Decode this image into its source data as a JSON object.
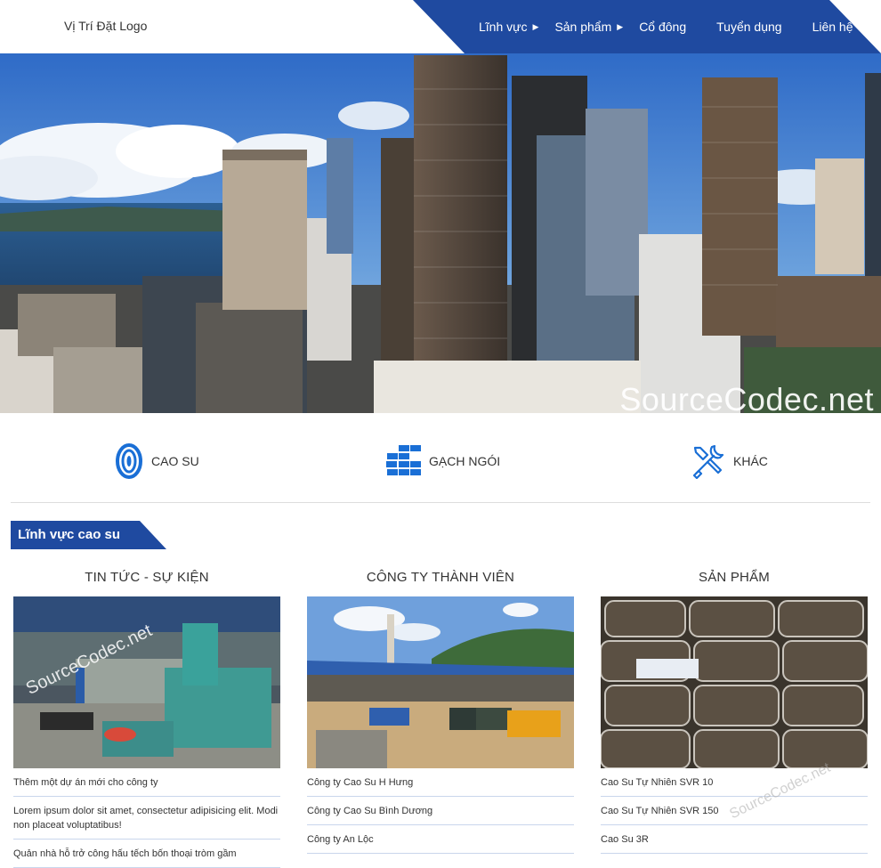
{
  "header": {
    "logo_text": "Vị Trí Đặt Logo",
    "nav": [
      {
        "label": "Lĩnh vực",
        "has_submenu": true
      },
      {
        "label": "Sản phẩm",
        "has_submenu": true
      },
      {
        "label": "Cổ đông",
        "has_submenu": false
      },
      {
        "label": "Tuyển dụng",
        "has_submenu": false
      },
      {
        "label": "Liên hệ",
        "has_submenu": false
      }
    ],
    "nav_caret": "▶",
    "accent_color": "#1f4aa0"
  },
  "hero": {
    "watermark": "SourceCodec.net"
  },
  "categories": [
    {
      "label": "CAO SU",
      "icon": "tire-icon"
    },
    {
      "label": "GẠCH NGÓI",
      "icon": "bricks-icon"
    },
    {
      "label": "KHÁC",
      "icon": "tools-icon"
    }
  ],
  "section": {
    "title": "Lĩnh vực cao su"
  },
  "columns": [
    {
      "title": "TIN TỨC - SỰ KIỆN",
      "watermark": "SourceCodec.net",
      "items": [
        "Thêm một dự án mới cho công ty",
        "Lorem ipsum dolor sit amet, consectetur adipisicing elit. Modi non placeat voluptatibus!",
        "Quản nhà hỗ trở công hấu tếch bốn thoại tròm gầm"
      ]
    },
    {
      "title": "CÔNG TY THÀNH VIÊN",
      "items": [
        "Công ty Cao Su H Hưng",
        "Công ty Cao Su Bình Dương",
        "Công ty An Lộc"
      ]
    },
    {
      "title": "SẢN PHẨM",
      "watermark": "SourceCodec.net",
      "items": [
        "Cao Su Tự Nhiên SVR 10",
        "Cao Su Tự Nhiên SVR 150",
        "Cao Su 3R"
      ]
    }
  ]
}
